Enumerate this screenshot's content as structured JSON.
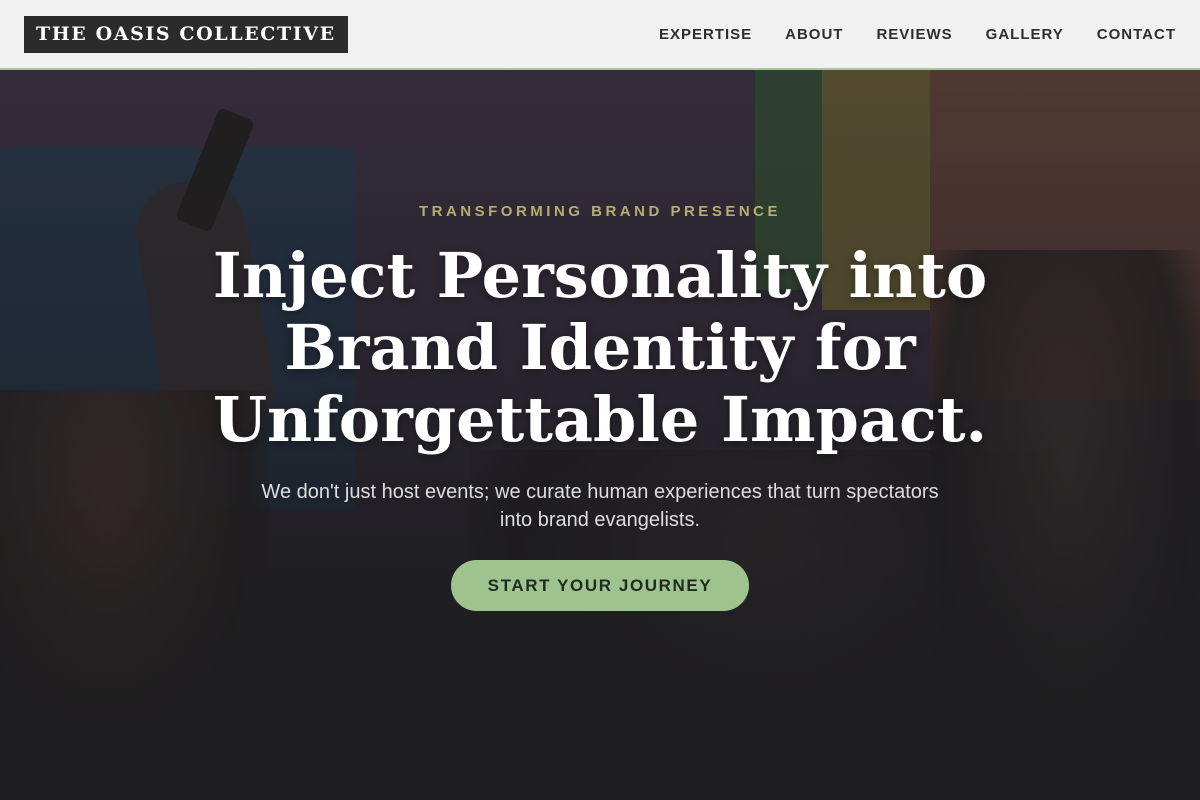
{
  "brand": {
    "logo_text": "THE OASIS COLLECTIVE"
  },
  "nav": {
    "items": [
      {
        "label": "EXPERTISE"
      },
      {
        "label": "ABOUT"
      },
      {
        "label": "REVIEWS"
      },
      {
        "label": "GALLERY"
      },
      {
        "label": "CONTACT"
      }
    ]
  },
  "hero": {
    "eyebrow": "TRANSFORMING BRAND PRESENCE",
    "headline": "Inject Personality into Brand Identity for Unforgettable Impact.",
    "subtext": "We don't just host events; we curate human experiences that turn spectators into brand evangelists.",
    "cta_label": "START YOUR JOURNEY",
    "background_image": "event-crowd-photo"
  },
  "colors": {
    "accent_green": "#9ec38f",
    "eyebrow_gold": "#b9ad6e",
    "header_bg": "#f1f1f1",
    "logo_bg": "#2b2b2b"
  }
}
